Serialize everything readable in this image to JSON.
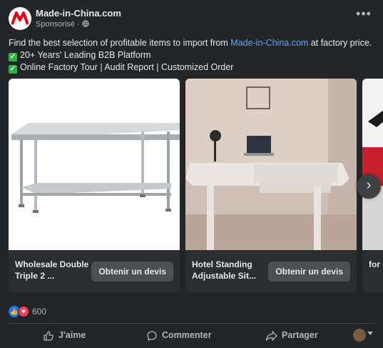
{
  "header": {
    "page_name": "Made-in-China.com",
    "sponsored_label": "Sponsorisé · ",
    "more_label": "•••"
  },
  "body": {
    "line1_before": "Find the best selection of profitable items to import from ",
    "line1_link": "Made-in-China.com",
    "line1_after": " at factory price.",
    "bullet1": "20+ Years' Leading B2B Platform",
    "bullet2": "Online Factory Tour | Audit Report  | Customized Order",
    "check_glyph": "✓"
  },
  "carousel": {
    "cards": [
      {
        "title": "Wholesale Double Triple 2 ...",
        "cta": "Obtenir un devis"
      },
      {
        "title": "Hotel Standing Adjustable Sit...",
        "cta": "Obtenir un devis"
      },
      {
        "title": "for Cou"
      }
    ],
    "next_label": "›"
  },
  "reactions": {
    "count": "600",
    "like_glyph": "👍",
    "love_glyph": "♥"
  },
  "actions": {
    "like": "J'aime",
    "comment": "Commenter",
    "share": "Partager"
  },
  "colors": {
    "background": "#242526",
    "link": "#5aa7ff",
    "accent_like": "#1877f2",
    "accent_love": "#f33e58",
    "check_green": "#2fb344"
  },
  "icons": [
    "made-in-china-logo",
    "globe-icon",
    "more-icon",
    "check-icon",
    "chevron-right-icon",
    "like-icon",
    "comment-icon",
    "share-icon"
  ]
}
